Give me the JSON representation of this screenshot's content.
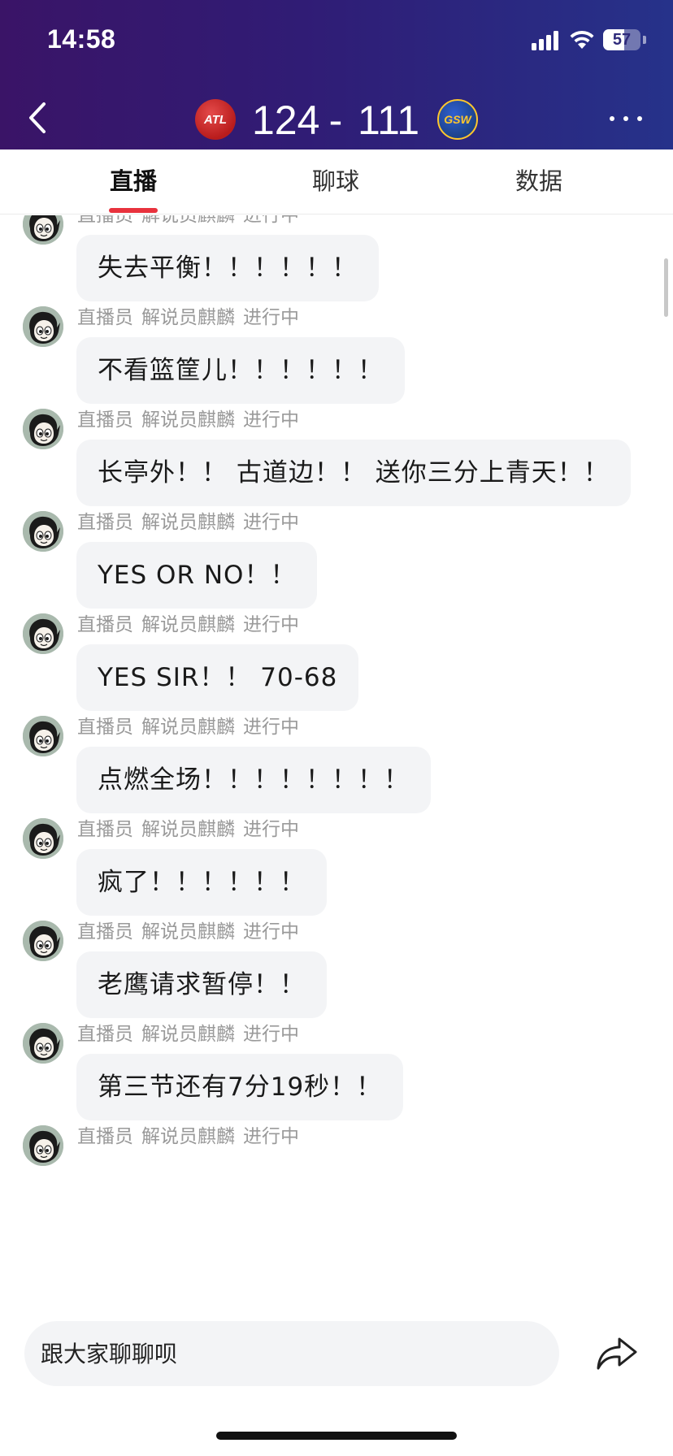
{
  "status_bar": {
    "time": "14:58",
    "battery": "57",
    "battery_level": 0.57
  },
  "header": {
    "home_team": {
      "abbr": "ATL",
      "score": "124",
      "color": "#c8102e"
    },
    "separator": "-",
    "away_team": {
      "abbr": "GSW",
      "score": "111",
      "color": "#1d428a"
    },
    "back_icon": "chevron-left-icon",
    "more_icon": "more-horizontal-icon"
  },
  "tabs": [
    {
      "label": "直播",
      "active": true
    },
    {
      "label": "聊球",
      "active": false
    },
    {
      "label": "数据",
      "active": false
    }
  ],
  "accent_color": "#e8323d",
  "messages": [
    {
      "role": "直播员",
      "name": "解说员麒麟",
      "status": "进行中",
      "text": "失去平衡！！！！！！"
    },
    {
      "role": "直播员",
      "name": "解说员麒麟",
      "status": "进行中",
      "text": "不看篮筐儿！！！！！！"
    },
    {
      "role": "直播员",
      "name": "解说员麒麟",
      "status": "进行中",
      "text": "长亭外！！ 古道边！！ 送你三分上青天！！"
    },
    {
      "role": "直播员",
      "name": "解说员麒麟",
      "status": "进行中",
      "text": "YES OR NO！！"
    },
    {
      "role": "直播员",
      "name": "解说员麒麟",
      "status": "进行中",
      "text": "YES SIR！！ 70-68"
    },
    {
      "role": "直播员",
      "name": "解说员麒麟",
      "status": "进行中",
      "text": "点燃全场！！！！！！！！"
    },
    {
      "role": "直播员",
      "name": "解说员麒麟",
      "status": "进行中",
      "text": "疯了！！！！！！"
    },
    {
      "role": "直播员",
      "name": "解说员麒麟",
      "status": "进行中",
      "text": "老鹰请求暂停！！"
    },
    {
      "role": "直播员",
      "name": "解说员麒麟",
      "status": "进行中",
      "text": "第三节还有7分19秒！！"
    },
    {
      "role": "直播员",
      "name": "解说员麒麟",
      "status": "进行中",
      "text": ""
    }
  ],
  "input": {
    "placeholder": "跟大家聊聊呗",
    "value": ""
  },
  "share_icon": "share-icon"
}
